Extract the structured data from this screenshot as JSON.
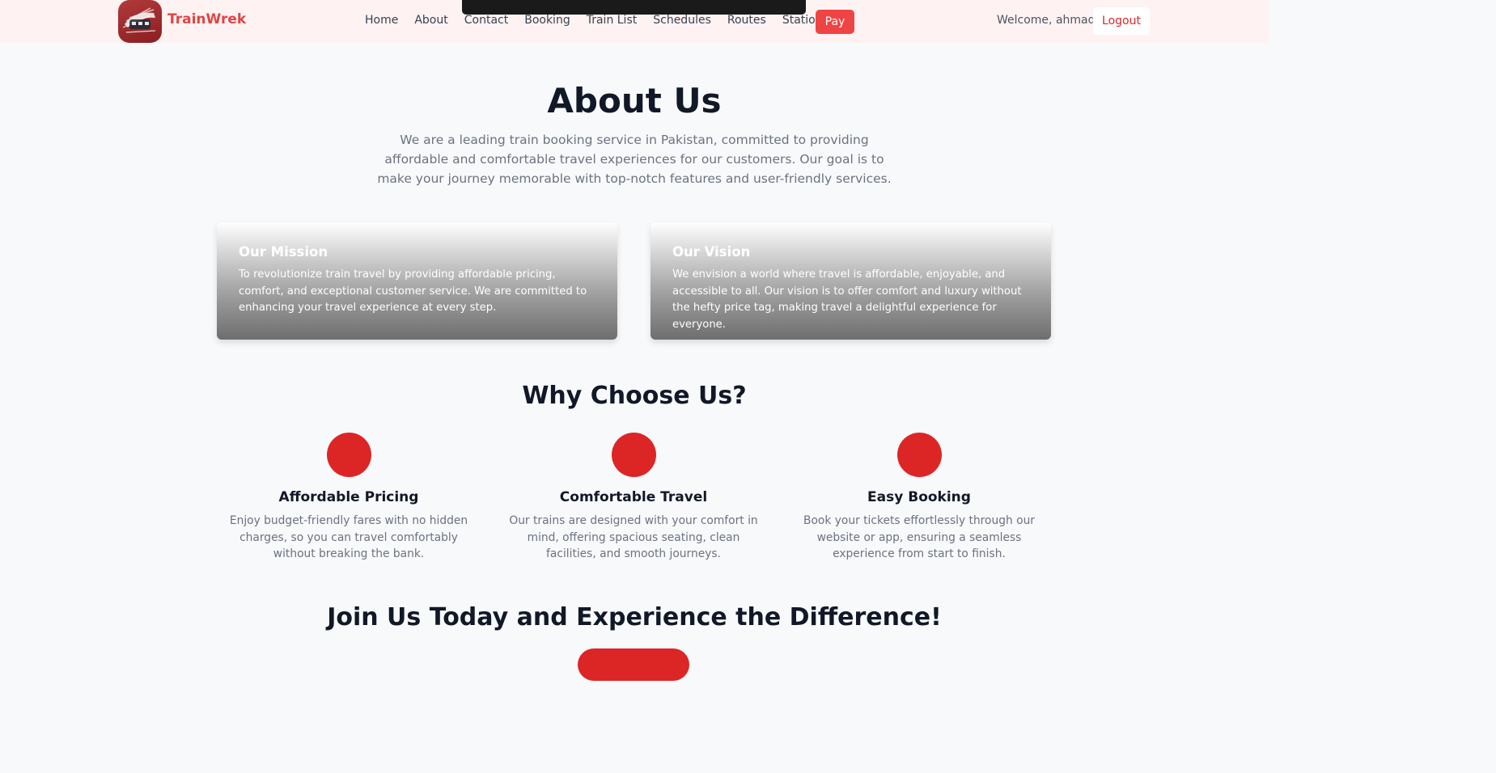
{
  "nav": {
    "brand": "TrainWrek",
    "links": [
      "Home",
      "About",
      "Contact",
      "Booking",
      "Train List",
      "Schedules",
      "Routes",
      "Stations"
    ],
    "pay_label": "Pay",
    "welcome": "Welcome, ahmad",
    "logout_label": "Logout"
  },
  "hero": {
    "title": "About Us",
    "intro": "We are a leading train booking service in Pakistan, committed to providing affordable and comfortable travel experiences for our customers. Our goal is to make your journey memorable with top-notch features and user-friendly services."
  },
  "cards": [
    {
      "title": "Our Mission",
      "text": "To revolutionize train travel by providing affordable pricing, comfort, and exceptional customer service. We are committed to enhancing your travel experience at every step."
    },
    {
      "title": "Our Vision",
      "text": "We envision a world where travel is affordable, enjoyable, and accessible to all. Our vision is to offer comfort and luxury without the hefty price tag, making travel a delightful experience for everyone."
    }
  ],
  "why": {
    "title": "Why Choose Us?",
    "features": [
      {
        "title": "Affordable Pricing",
        "text": "Enjoy budget-friendly fares with no hidden charges, so you can travel comfortably without breaking the bank."
      },
      {
        "title": "Comfortable Travel",
        "text": "Our trains are designed with your comfort in mind, offering spacious seating, clean facilities, and smooth journeys."
      },
      {
        "title": "Easy Booking",
        "text": "Book your tickets effortlessly through our website or app, ensuring a seamless experience from start to finish."
      }
    ]
  },
  "join": {
    "title": "Join Us Today and Experience the Difference!"
  },
  "colors": {
    "accent": "#dc2626",
    "brand": "#e04444",
    "navbar_bg": "#fef2f2"
  }
}
